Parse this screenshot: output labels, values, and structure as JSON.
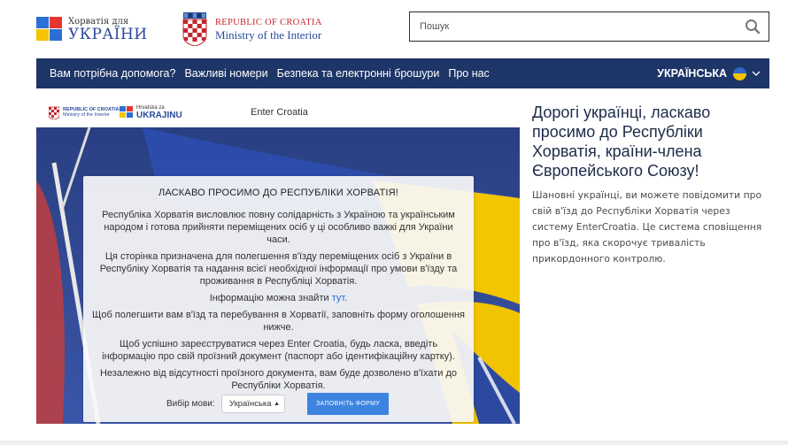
{
  "header": {
    "logo_small": "Хорватія для",
    "logo_big": "УКРАЇНИ",
    "ministry_line1": "REPUBLIC OF CROATIA",
    "ministry_line2": "Ministry of the Interior",
    "search_placeholder": "Пошук"
  },
  "nav": {
    "items": [
      {
        "label": "Вам потрібна допомога?"
      },
      {
        "label": "Важливі номери"
      },
      {
        "label": "Безпека та електронні брошури"
      },
      {
        "label": "Про нас"
      }
    ],
    "language": "УКРАЇНСЬКА"
  },
  "panel": {
    "mini_logo_line1": "REPUBLIC OF CROATIA",
    "mini_logo_line2": "Ministry of the Interior",
    "mini_hr_line1": "Hrvatska za",
    "mini_hr_line2": "UKRAJINU",
    "app_title": "Enter Croatia",
    "card": {
      "title": "ЛАСКАВО ПРОСИМО ДО РЕСПУБЛІКИ ХОРВАТІЯ!",
      "p1": "Республіка Хорватія висловлює повну солідарність з Україною та українським народом і готова прийняти переміщених осіб у ці особливо важкі для України часи.",
      "p2": "Ця сторінка призначена для полегшення в'їзду переміщених осіб з України в Республіку Хорватія та надання всієї необхідної інформації про умови в'їзду та проживання в Республіці Хорватія.",
      "p3_text": "Інформацію можна знайти",
      "p3_link": "тут.",
      "p4": "Щоб полегшити вам в'їзд та перебування в Хорватії, заповніть форму оголошення нижче.",
      "p5": "Щоб успішно зареєструватися через Enter Croatia, будь ласка, введіть інформацію про свій проїзний документ (паспорт або ідентифікаційну картку).",
      "p6": "Незалежно від відсутності проїзного документа, вам буде дозволено в'їхати до Республіки Хорватія.",
      "lang_label": "Вибір мови:",
      "lang_value": "Українська",
      "button": "ЗАПОВНІТЬ ФОРМУ"
    }
  },
  "right": {
    "title": "Дорогі українці, ласкаво просимо до Республіки Хорватія, країни-члена Європейського Союзу!",
    "text": "Шановні українці, ви можете повідомити про свій в'їзд до Республіки Хорватія через систему EnterCroatia. Це система сповіщення про в'їзд, яка скорочує тривалість прикордонного контролю."
  },
  "colors": {
    "nav_bg": "#1d3567",
    "accent_button": "#3c84e0",
    "link": "#1e6fd9",
    "logo_blue": "#2a4a9a",
    "croatia_red": "#c4262e"
  }
}
